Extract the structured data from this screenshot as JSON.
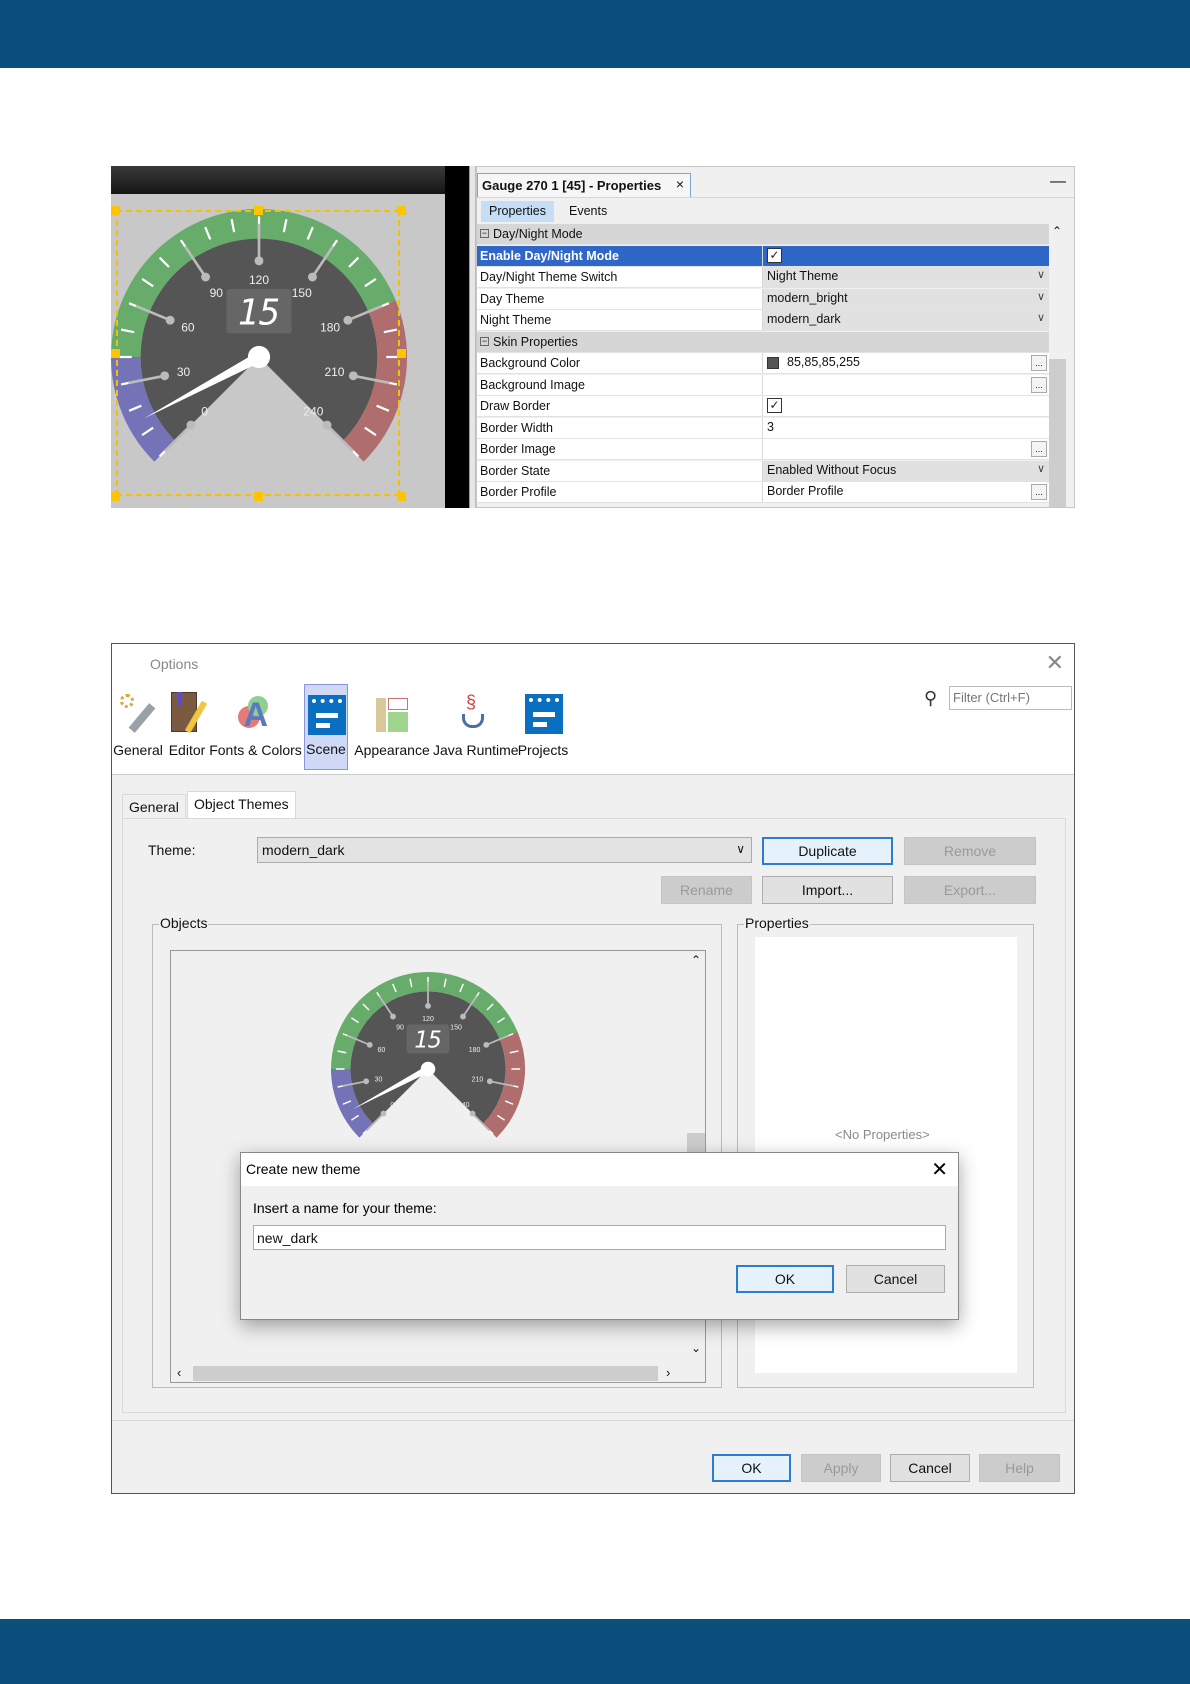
{
  "colors": {
    "brand": "#0b4f7c",
    "selection": "#2f67c8",
    "accent_blue": "#2c7bd4"
  },
  "gauge": {
    "value": 15,
    "display": "15",
    "min": 0,
    "max": 240,
    "labels": [
      "0",
      "30",
      "60",
      "90",
      "120",
      "150",
      "180",
      "210",
      "240"
    ],
    "zones": [
      {
        "from": 0,
        "to": 40,
        "color": "#7473b8"
      },
      {
        "from": 40,
        "to": 180,
        "color": "#67ac6a"
      },
      {
        "from": 180,
        "to": 240,
        "color": "#b06d6d"
      }
    ],
    "face_color": "#555555"
  },
  "properties_panel": {
    "title": "Gauge 270 1 [45] - Properties",
    "close_icon": "×",
    "minimize_icon": "—",
    "tabs": [
      "Properties",
      "Events"
    ],
    "rows": [
      {
        "type": "group",
        "name": "Day/Night Mode"
      },
      {
        "type": "check",
        "name": "Enable Day/Night Mode",
        "checked": true,
        "selected": true
      },
      {
        "type": "combo",
        "name": "Day/Night Theme Switch",
        "value": "Night Theme"
      },
      {
        "type": "combo",
        "name": "Day Theme",
        "value": "modern_bright"
      },
      {
        "type": "combo",
        "name": "Night Theme",
        "value": "modern_dark"
      },
      {
        "type": "group",
        "name": "Skin Properties"
      },
      {
        "type": "color",
        "name": "Background Color",
        "value": "85,85,85,255"
      },
      {
        "type": "ellipsis",
        "name": "Background Image",
        "value": ""
      },
      {
        "type": "check",
        "name": "Draw Border",
        "checked": true
      },
      {
        "type": "text",
        "name": "Border Width",
        "value": "3"
      },
      {
        "type": "ellipsis",
        "name": "Border Image",
        "value": ""
      },
      {
        "type": "combo",
        "name": "Border State",
        "value": "Enabled Without Focus"
      },
      {
        "type": "ellipsis",
        "name": "Border Profile",
        "value": "Border Profile"
      }
    ]
  },
  "options": {
    "title": "Options",
    "categories": [
      {
        "label": "General",
        "icon": "wrench-gear-icon"
      },
      {
        "label": "Editor",
        "icon": "book-pencil-icon"
      },
      {
        "label": "Fonts & Colors",
        "icon": "fonts-colors-icon"
      },
      {
        "label": "Scene",
        "icon": "scene-icon",
        "active": true
      },
      {
        "label": "Appearance",
        "icon": "layout-icon"
      },
      {
        "label": "Java Runtime",
        "icon": "java-cup-icon"
      },
      {
        "label": "Projects",
        "icon": "projects-icon"
      }
    ],
    "filter_placeholder": "Filter (Ctrl+F)",
    "tabs": [
      "General",
      "Object Themes"
    ],
    "theme_label": "Theme:",
    "theme_value": "modern_dark",
    "buttons": {
      "duplicate": "Duplicate",
      "remove": "Remove",
      "rename": "Rename",
      "import": "Import...",
      "export": "Export..."
    },
    "objects_label": "Objects",
    "properties_label": "Properties",
    "no_properties": "<No Properties>",
    "footer": {
      "ok": "OK",
      "apply": "Apply",
      "cancel": "Cancel",
      "help": "Help"
    }
  },
  "create_dialog": {
    "title": "Create new theme",
    "prompt": "Insert a name for your theme:",
    "value": "new_dark",
    "ok": "OK",
    "cancel": "Cancel"
  }
}
